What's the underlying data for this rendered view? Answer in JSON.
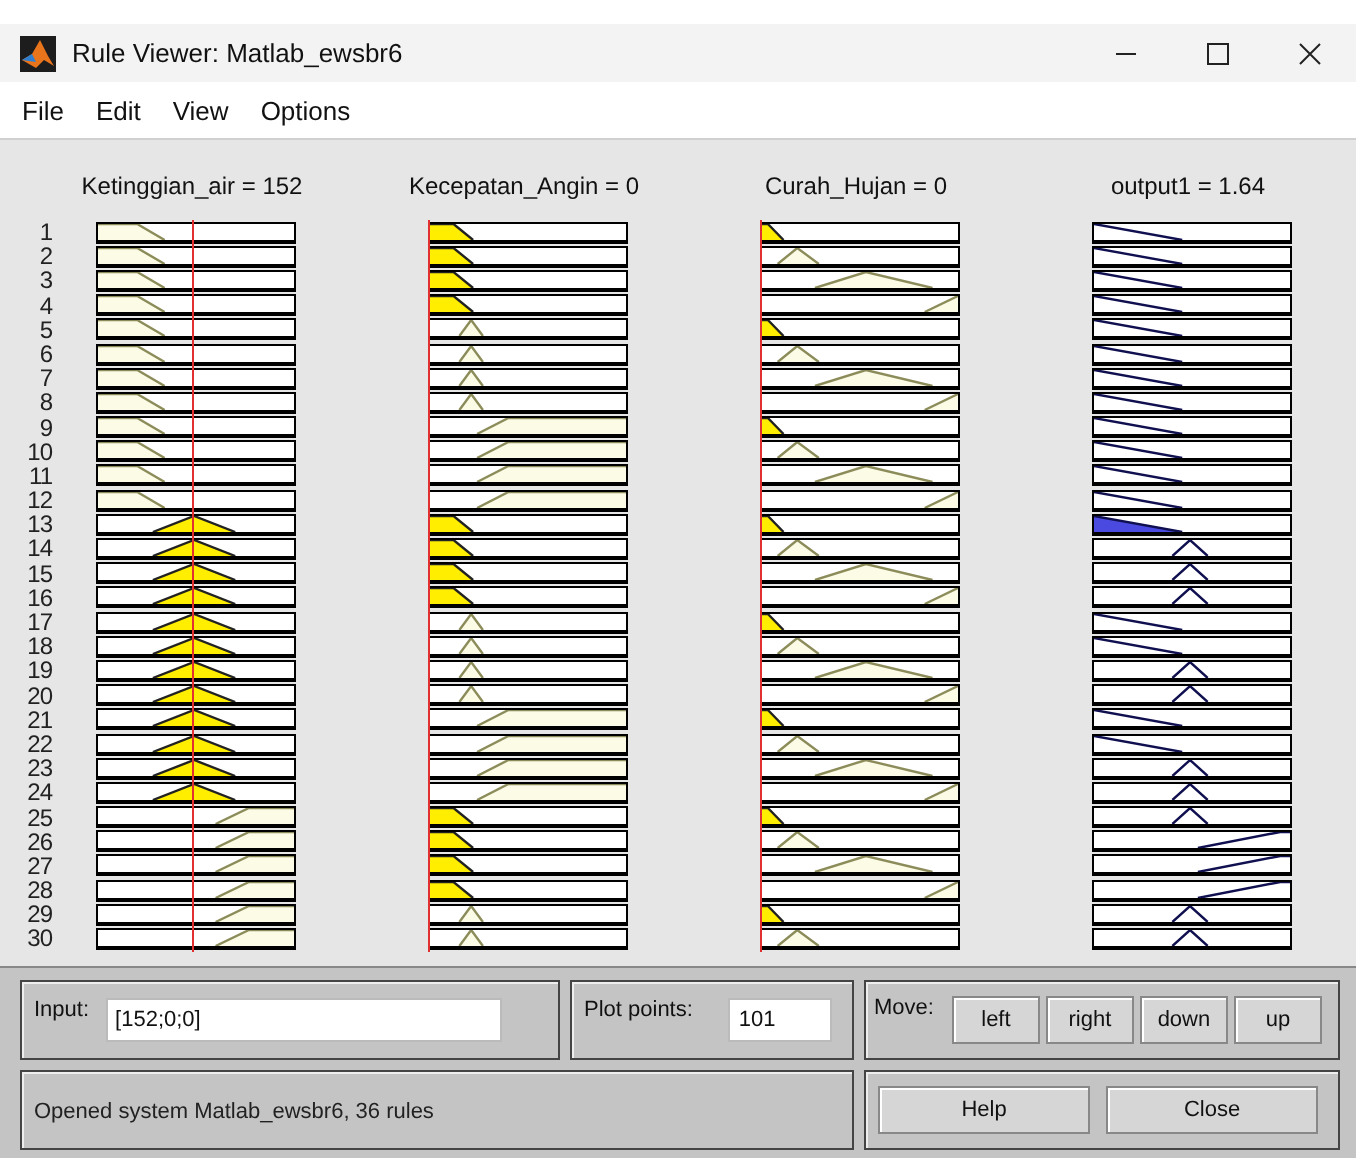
{
  "window": {
    "title": "Rule Viewer: Matlab_ewsbr6"
  },
  "menu": [
    "File",
    "Edit",
    "View",
    "Options"
  ],
  "columns": [
    {
      "header": "Ketinggian_air = 152",
      "kind": "input",
      "level": 0.49
    },
    {
      "header": "Kecepatan_Angin = 0",
      "kind": "input",
      "level": 0
    },
    {
      "header": "Curah_Hujan = 0",
      "kind": "input",
      "level": 0
    },
    {
      "header": "output1 = 1.64",
      "kind": "output"
    }
  ],
  "rules": [
    {
      "number": "1",
      "cells": [
        {
          "kind": "low",
          "fired": false
        },
        {
          "kind": "low",
          "fired": true
        },
        {
          "kind": "low",
          "fired": true
        },
        {
          "kind": "low",
          "fired": false
        }
      ]
    },
    {
      "number": "2",
      "cells": [
        {
          "kind": "low",
          "fired": false
        },
        {
          "kind": "low",
          "fired": true
        },
        {
          "kind": "mid",
          "fired": false
        },
        {
          "kind": "low",
          "fired": false
        }
      ]
    },
    {
      "number": "3",
      "cells": [
        {
          "kind": "low",
          "fired": false
        },
        {
          "kind": "low",
          "fired": true
        },
        {
          "kind": "wide",
          "fired": false
        },
        {
          "kind": "low",
          "fired": false
        }
      ]
    },
    {
      "number": "4",
      "cells": [
        {
          "kind": "low",
          "fired": false
        },
        {
          "kind": "low",
          "fired": true
        },
        {
          "kind": "high",
          "fired": false
        },
        {
          "kind": "low",
          "fired": false
        }
      ]
    },
    {
      "number": "5",
      "cells": [
        {
          "kind": "low",
          "fired": false
        },
        {
          "kind": "mid",
          "fired": false
        },
        {
          "kind": "low",
          "fired": true
        },
        {
          "kind": "low",
          "fired": false
        }
      ]
    },
    {
      "number": "6",
      "cells": [
        {
          "kind": "low",
          "fired": false
        },
        {
          "kind": "mid",
          "fired": false
        },
        {
          "kind": "mid",
          "fired": false
        },
        {
          "kind": "low",
          "fired": false
        }
      ]
    },
    {
      "number": "7",
      "cells": [
        {
          "kind": "low",
          "fired": false
        },
        {
          "kind": "mid",
          "fired": false
        },
        {
          "kind": "wide",
          "fired": false
        },
        {
          "kind": "low",
          "fired": false
        }
      ]
    },
    {
      "number": "8",
      "cells": [
        {
          "kind": "low",
          "fired": false
        },
        {
          "kind": "mid",
          "fired": false
        },
        {
          "kind": "high",
          "fired": false
        },
        {
          "kind": "low",
          "fired": false
        }
      ]
    },
    {
      "number": "9",
      "cells": [
        {
          "kind": "low",
          "fired": false
        },
        {
          "kind": "high",
          "fired": false
        },
        {
          "kind": "low",
          "fired": true
        },
        {
          "kind": "low",
          "fired": false
        }
      ]
    },
    {
      "number": "10",
      "cells": [
        {
          "kind": "low",
          "fired": false
        },
        {
          "kind": "high",
          "fired": false
        },
        {
          "kind": "mid",
          "fired": false
        },
        {
          "kind": "low",
          "fired": false
        }
      ]
    },
    {
      "number": "11",
      "cells": [
        {
          "kind": "low",
          "fired": false
        },
        {
          "kind": "high",
          "fired": false
        },
        {
          "kind": "wide",
          "fired": false
        },
        {
          "kind": "low",
          "fired": false
        }
      ]
    },
    {
      "number": "12",
      "cells": [
        {
          "kind": "low",
          "fired": false
        },
        {
          "kind": "high",
          "fired": false
        },
        {
          "kind": "high",
          "fired": false
        },
        {
          "kind": "low",
          "fired": false
        }
      ]
    },
    {
      "number": "13",
      "cells": [
        {
          "kind": "mid",
          "fired": true
        },
        {
          "kind": "low",
          "fired": true
        },
        {
          "kind": "low",
          "fired": true
        },
        {
          "kind": "low",
          "fired": true
        }
      ]
    },
    {
      "number": "14",
      "cells": [
        {
          "kind": "mid",
          "fired": true
        },
        {
          "kind": "low",
          "fired": true
        },
        {
          "kind": "mid",
          "fired": false
        },
        {
          "kind": "mid",
          "fired": false
        }
      ]
    },
    {
      "number": "15",
      "cells": [
        {
          "kind": "mid",
          "fired": true
        },
        {
          "kind": "low",
          "fired": true
        },
        {
          "kind": "wide",
          "fired": false
        },
        {
          "kind": "mid",
          "fired": false
        }
      ]
    },
    {
      "number": "16",
      "cells": [
        {
          "kind": "mid",
          "fired": true
        },
        {
          "kind": "low",
          "fired": true
        },
        {
          "kind": "high",
          "fired": false
        },
        {
          "kind": "mid",
          "fired": false
        }
      ]
    },
    {
      "number": "17",
      "cells": [
        {
          "kind": "mid",
          "fired": true
        },
        {
          "kind": "mid",
          "fired": false
        },
        {
          "kind": "low",
          "fired": true
        },
        {
          "kind": "low",
          "fired": false
        }
      ]
    },
    {
      "number": "18",
      "cells": [
        {
          "kind": "mid",
          "fired": true
        },
        {
          "kind": "mid",
          "fired": false
        },
        {
          "kind": "mid",
          "fired": false
        },
        {
          "kind": "low",
          "fired": false
        }
      ]
    },
    {
      "number": "19",
      "cells": [
        {
          "kind": "mid",
          "fired": true
        },
        {
          "kind": "mid",
          "fired": false
        },
        {
          "kind": "wide",
          "fired": false
        },
        {
          "kind": "mid",
          "fired": false
        }
      ]
    },
    {
      "number": "20",
      "cells": [
        {
          "kind": "mid",
          "fired": true
        },
        {
          "kind": "mid",
          "fired": false
        },
        {
          "kind": "high",
          "fired": false
        },
        {
          "kind": "mid",
          "fired": false
        }
      ]
    },
    {
      "number": "21",
      "cells": [
        {
          "kind": "mid",
          "fired": true
        },
        {
          "kind": "high",
          "fired": false
        },
        {
          "kind": "low",
          "fired": true
        },
        {
          "kind": "low",
          "fired": false
        }
      ]
    },
    {
      "number": "22",
      "cells": [
        {
          "kind": "mid",
          "fired": true
        },
        {
          "kind": "high",
          "fired": false
        },
        {
          "kind": "mid",
          "fired": false
        },
        {
          "kind": "low",
          "fired": false
        }
      ]
    },
    {
      "number": "23",
      "cells": [
        {
          "kind": "mid",
          "fired": true
        },
        {
          "kind": "high",
          "fired": false
        },
        {
          "kind": "wide",
          "fired": false
        },
        {
          "kind": "mid",
          "fired": false
        }
      ]
    },
    {
      "number": "24",
      "cells": [
        {
          "kind": "mid",
          "fired": true
        },
        {
          "kind": "high",
          "fired": false
        },
        {
          "kind": "high",
          "fired": false
        },
        {
          "kind": "mid",
          "fired": false
        }
      ]
    },
    {
      "number": "25",
      "cells": [
        {
          "kind": "high",
          "fired": false
        },
        {
          "kind": "low",
          "fired": true
        },
        {
          "kind": "low",
          "fired": true
        },
        {
          "kind": "mid",
          "fired": false
        }
      ]
    },
    {
      "number": "26",
      "cells": [
        {
          "kind": "high",
          "fired": false
        },
        {
          "kind": "low",
          "fired": true
        },
        {
          "kind": "mid",
          "fired": false
        },
        {
          "kind": "high",
          "fired": false
        }
      ]
    },
    {
      "number": "27",
      "cells": [
        {
          "kind": "high",
          "fired": false
        },
        {
          "kind": "low",
          "fired": true
        },
        {
          "kind": "wide",
          "fired": false
        },
        {
          "kind": "high",
          "fired": false
        }
      ]
    },
    {
      "number": "28",
      "cells": [
        {
          "kind": "high",
          "fired": false
        },
        {
          "kind": "low",
          "fired": true
        },
        {
          "kind": "high",
          "fired": false
        },
        {
          "kind": "high",
          "fired": false
        }
      ]
    },
    {
      "number": "29",
      "cells": [
        {
          "kind": "high",
          "fired": false
        },
        {
          "kind": "mid",
          "fired": false
        },
        {
          "kind": "low",
          "fired": true
        },
        {
          "kind": "mid",
          "fired": false
        }
      ]
    },
    {
      "number": "30",
      "cells": [
        {
          "kind": "high",
          "fired": false
        },
        {
          "kind": "mid",
          "fired": false
        },
        {
          "kind": "mid",
          "fired": false
        },
        {
          "kind": "mid",
          "fired": false
        }
      ]
    }
  ],
  "input": {
    "label": "Input:",
    "value": "[152;0;0]"
  },
  "plot_points": {
    "label": "Plot points:",
    "value": "101"
  },
  "move": {
    "label": "Move:",
    "buttons": [
      "left",
      "right",
      "down",
      "up"
    ]
  },
  "status": "Opened system Matlab_ewsbr6, 36 rules",
  "buttons": [
    "Help",
    "Close"
  ]
}
